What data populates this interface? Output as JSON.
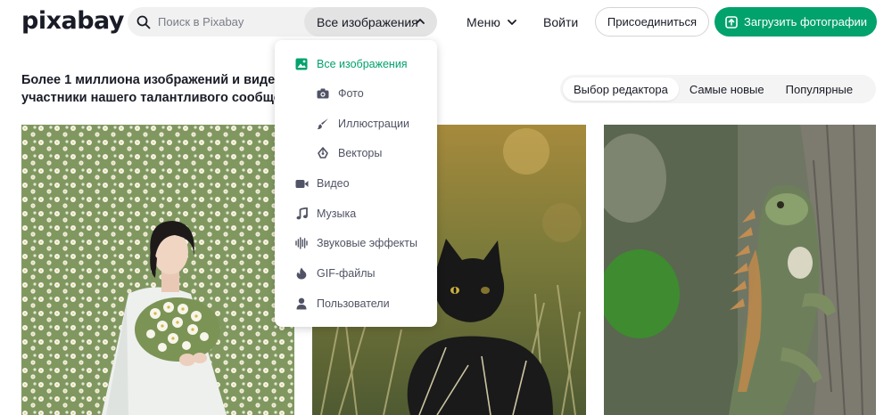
{
  "header": {
    "logo": "pixabay",
    "search_placeholder": "Поиск в Pixabay",
    "filter_label": "Все изображения",
    "menu_label": "Меню",
    "login_label": "Войти",
    "join_label": "Присоединиться",
    "upload_label": "Загрузить фотографии"
  },
  "headline": "Более 1 миллиона изображений и видео, которыми поделились участники нашего талантливого сообщества.",
  "tabs": [
    {
      "label": "Выбор редактора",
      "active": true
    },
    {
      "label": "Самые новые",
      "active": false
    },
    {
      "label": "Популярные",
      "active": false
    }
  ],
  "dropdown": {
    "items": [
      {
        "label": "Все изображения",
        "icon": "image-icon",
        "active": true
      },
      {
        "label": "Фото",
        "icon": "camera-icon"
      },
      {
        "label": "Иллюстрации",
        "icon": "brush-icon"
      },
      {
        "label": "Векторы",
        "icon": "pen-nib-icon"
      },
      {
        "label": "Видео",
        "icon": "video-icon"
      },
      {
        "label": "Музыка",
        "icon": "music-note-icon"
      },
      {
        "label": "Звуковые эффекты",
        "icon": "sound-wave-icon"
      },
      {
        "label": "GIF-файлы",
        "icon": "flame-icon"
      },
      {
        "label": "Пользователи",
        "icon": "user-icon"
      }
    ]
  },
  "colors": {
    "accent": "#02a26c",
    "text": "#191b26",
    "muted_text": "#505365"
  }
}
